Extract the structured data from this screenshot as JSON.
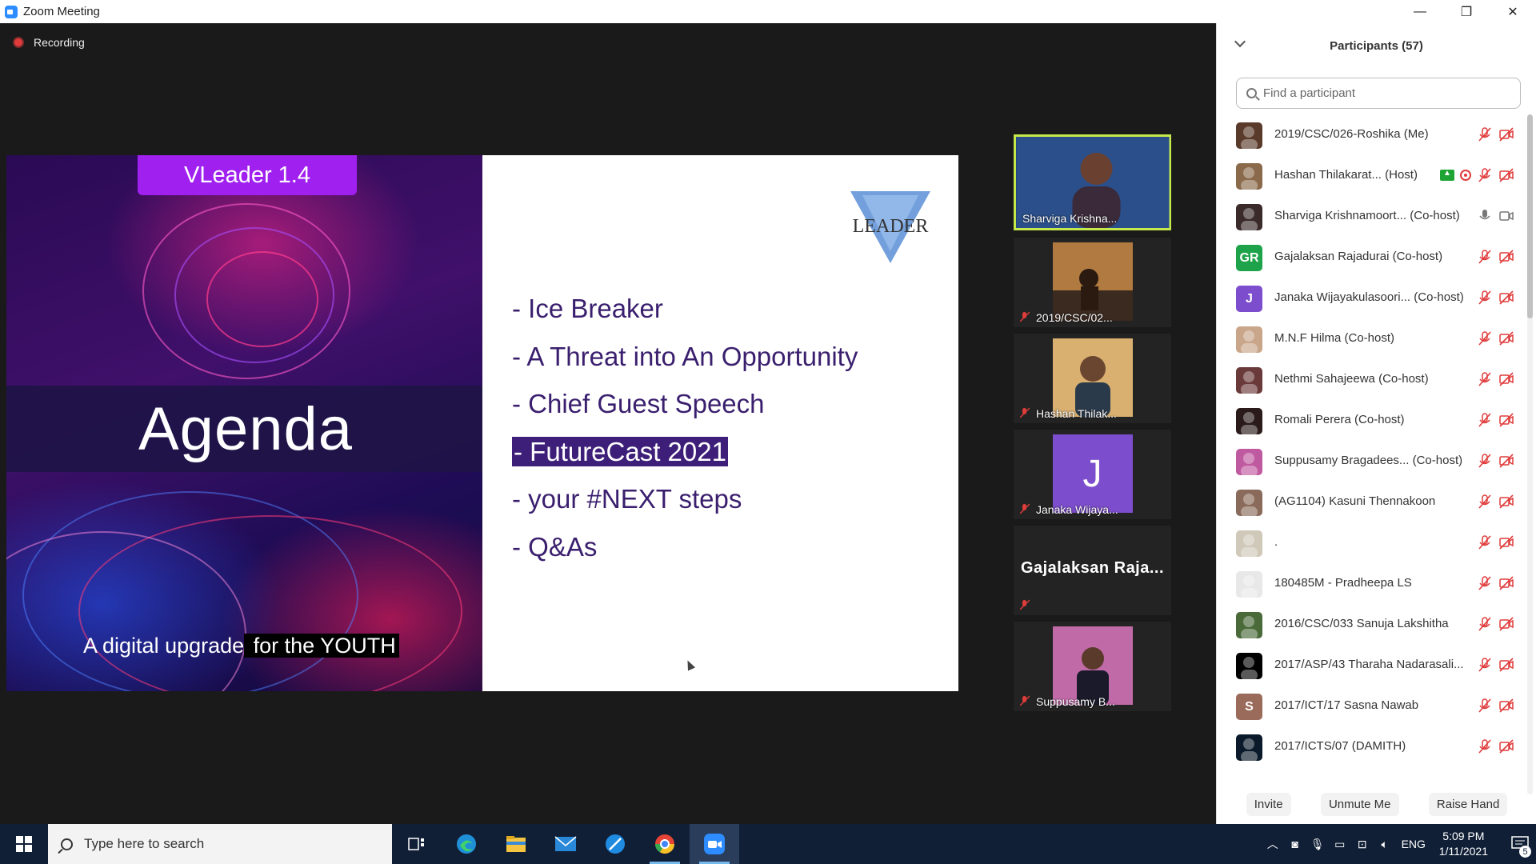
{
  "window": {
    "title": "Zoom Meeting",
    "minimize": "—",
    "restore": "❐",
    "close": "✕"
  },
  "recording": {
    "label": "Recording"
  },
  "slide": {
    "badge": "VLeader 1.4",
    "heading": "Agenda",
    "tagline_part1": "A digital upgrade",
    "tagline_part2": " for the YOUTH",
    "logo_text": "LEADER",
    "items": [
      "- Ice Breaker",
      "- A Threat into An Opportunity",
      "- Chief Guest Speech",
      "- FutureCast 2021",
      "- your #NEXT steps",
      "- Q&As"
    ]
  },
  "videos": [
    {
      "name": "Sharviga Krishna...",
      "muted": false,
      "active": true
    },
    {
      "name": "2019/CSC/02...",
      "muted": true
    },
    {
      "name": "Hashan Thilak...",
      "muted": true
    },
    {
      "name": "Janaka Wijaya...",
      "muted": true,
      "initial": "J",
      "color": "#7c4dcc"
    },
    {
      "name": "Gajalaksan   Raja...",
      "muted": true
    },
    {
      "name": "Suppusamy B...",
      "muted": true
    }
  ],
  "panel": {
    "title": "Participants (57)",
    "search_placeholder": "Find a participant",
    "participants": [
      {
        "name": "2019/CSC/026-Roshika (Me)",
        "avatar_color": "#5a3a2a"
      },
      {
        "name": "Hashan Thilakarat...  (Host)",
        "avatar_color": "#8a6a4a"
      },
      {
        "name": "Sharviga Krishnamoort...  (Co-host)",
        "avatar_color": "#3a2a2a"
      },
      {
        "name": "Gajalaksan Rajadurai (Co-host)",
        "initials": "GR",
        "avatar_color": "#1ea34a"
      },
      {
        "name": "Janaka Wijayakulasoori...  (Co-host)",
        "initials": "J",
        "avatar_color": "#7c4dcc"
      },
      {
        "name": "M.N.F Hilma (Co-host)",
        "avatar_color": "#c9a58a"
      },
      {
        "name": "Nethmi Sahajeewa (Co-host)",
        "avatar_color": "#6a3a3a"
      },
      {
        "name": "Romali Perera (Co-host)",
        "avatar_color": "#2a1a1a"
      },
      {
        "name": "Suppusamy Bragadees...  (Co-host)",
        "avatar_color": "#c05aa0"
      },
      {
        "name": "(AG1104) Kasuni Thennakoon",
        "avatar_color": "#8a6a5a"
      },
      {
        "name": ".",
        "avatar_color": "#d0c8b8"
      },
      {
        "name": "180485M - Pradheepa LS",
        "avatar_color": "#e8e8e8"
      },
      {
        "name": "2016/CSC/033 Sanuja Lakshitha",
        "avatar_color": "#4a6a3a"
      },
      {
        "name": "2017/ASP/43 Tharaha Nadarasali...",
        "avatar_color": "#000000"
      },
      {
        "name": "2017/ICT/17 Sasna Nawab",
        "initials": "S",
        "avatar_color": "#9a6a5a"
      },
      {
        "name": "2017/ICTS/07 (DAMITH)",
        "avatar_color": "#0a1a2a"
      }
    ],
    "buttons": {
      "invite": "Invite",
      "unmute": "Unmute Me",
      "raise": "Raise Hand"
    }
  },
  "taskbar": {
    "search_placeholder": "Type here to search",
    "lang": "ENG",
    "time": "5:09 PM",
    "date": "1/11/2021",
    "notifications": "5"
  }
}
